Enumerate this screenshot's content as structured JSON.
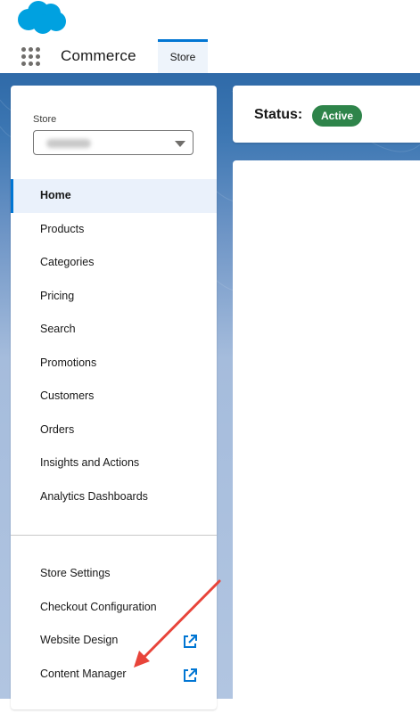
{
  "header": {
    "app_name": "Commerce",
    "tab_label": "Store",
    "brand_color": "#00a1e0",
    "accent_color": "#0176d3"
  },
  "sidebar": {
    "store_label": "Store",
    "store_value_obscured": true,
    "nav_items": [
      {
        "label": "Home",
        "active": true
      },
      {
        "label": "Products"
      },
      {
        "label": "Categories"
      },
      {
        "label": "Pricing"
      },
      {
        "label": "Search"
      },
      {
        "label": "Promotions"
      },
      {
        "label": "Customers"
      },
      {
        "label": "Orders"
      },
      {
        "label": "Insights and Actions"
      },
      {
        "label": "Analytics Dashboards"
      }
    ],
    "settings_items": [
      {
        "label": "Store Settings"
      },
      {
        "label": "Checkout Configuration"
      },
      {
        "label": "Website Design",
        "icon": "external-link-icon"
      },
      {
        "label": "Content Manager",
        "icon": "external-link-icon"
      }
    ]
  },
  "status": {
    "label": "Status:",
    "badge": "Active",
    "badge_color": "#2e844a"
  },
  "annotation": {
    "color": "#e8443a",
    "points_to": "Content Manager"
  }
}
